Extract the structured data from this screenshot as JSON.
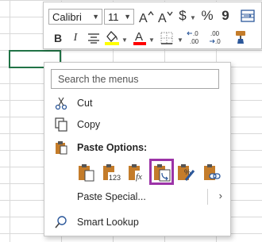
{
  "mini_toolbar": {
    "font_name": "Calibri",
    "font_size": "11",
    "grow_font_icon": "A^",
    "shrink_font_icon": "Aˇ",
    "currency_symbol": "$",
    "percent_symbol": "%",
    "comma_style_icon": "9",
    "bold_label": "B",
    "italic_label": "I",
    "font_color_label": "A",
    "increase_decimal_label": "←.0 .00",
    "decrease_decimal_label": ".00 →.0"
  },
  "context_menu": {
    "search_placeholder": "Search the menus",
    "cut_label": "Cut",
    "cut_hotkey_char": "t",
    "copy_label": "Copy",
    "paste_options_label": "Paste Options:",
    "paste_special_label": "Paste Special...",
    "smart_lookup_label": "Smart Lookup"
  },
  "colors": {
    "highlight_box": "#9c33a7",
    "fill_color_swatch": "#ffff00",
    "font_color_swatch": "#ff0000",
    "active_cell_border": "#217346",
    "clipboard_orange": "#c47c2a"
  }
}
